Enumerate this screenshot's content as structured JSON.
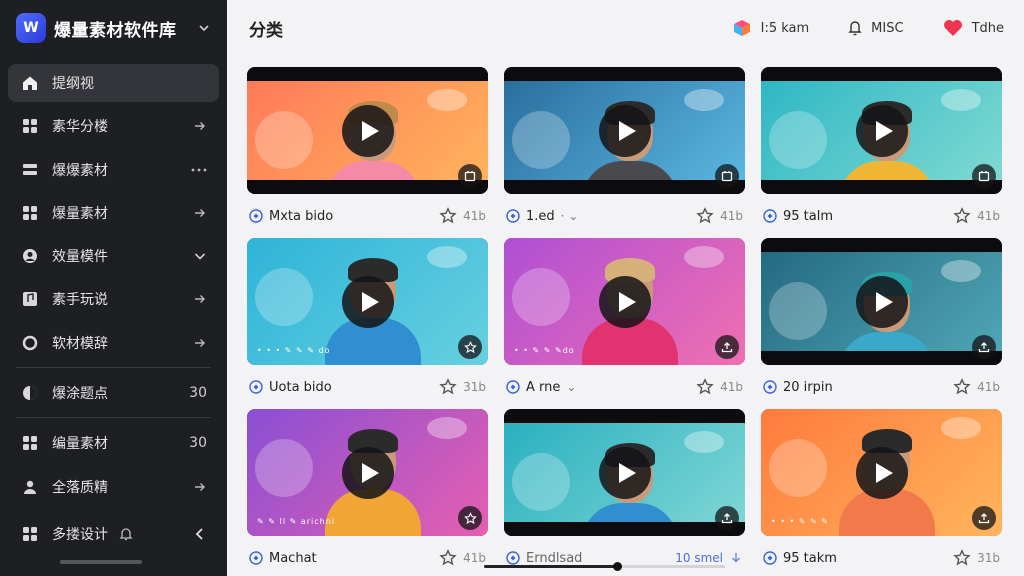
{
  "app": {
    "logo_letter": "W",
    "title": "爆量素材软件库"
  },
  "sidebar": {
    "items": [
      {
        "label": "提纲视",
        "icon": "home-icon",
        "trail": "",
        "active": true
      },
      {
        "label": "素华分楼",
        "icon": "grid-icon",
        "trail": "arrow"
      },
      {
        "label": "爆爆素材",
        "icon": "layers-icon",
        "trail": "dots"
      },
      {
        "label": "爆量素材",
        "icon": "grid-icon",
        "trail": "arrow"
      },
      {
        "label": "效量模件",
        "icon": "user-circle-icon",
        "trail": "chevron"
      },
      {
        "label": "素手玩说",
        "icon": "music-icon",
        "trail": "arrow"
      },
      {
        "label": "软材模辞",
        "icon": "ring-icon",
        "trail": "arrow"
      },
      {
        "label": "爆涂题点",
        "icon": "half-circle-icon",
        "trail": "30"
      },
      {
        "label": "编量素材",
        "icon": "grid-icon",
        "trail": "30"
      },
      {
        "label": "全落质精",
        "icon": "person-icon",
        "trail": "arrow"
      }
    ],
    "footer_label": "多搂设计"
  },
  "header": {
    "title": "分类",
    "actions": [
      {
        "label": "I:5 kam",
        "icon": "gift-icon"
      },
      {
        "label": "MISC",
        "icon": "bell-icon"
      },
      {
        "label": "Tdhe",
        "icon": "heart-icon"
      }
    ]
  },
  "cards": [
    {
      "title": "Mxta bido",
      "extra": "",
      "count": "41b",
      "corner": "frame-icon",
      "dots": "",
      "bands": true,
      "bg": [
        "#ff7a59",
        "#ffb35c"
      ],
      "hair": "#c08a4a",
      "shirt": "#f58aa8",
      "meta_icon": "shield-icon",
      "right_icon": "star-icon"
    },
    {
      "title": "1.ed",
      "extra": "·  ⌄",
      "count": "41b",
      "corner": "frame-icon",
      "dots": "",
      "bands": true,
      "bg": [
        "#2a6f9e",
        "#5ab6e0"
      ],
      "hair": "#2b2b2b",
      "shirt": "#4a4a4e",
      "meta_icon": "shield-icon",
      "right_icon": "star-icon"
    },
    {
      "title": "95 talm",
      "extra": "",
      "count": "41b",
      "corner": "frame-icon",
      "dots": "",
      "bands": true,
      "bg": [
        "#2fb7c4",
        "#7fd9d2"
      ],
      "hair": "#2b2b2b",
      "shirt": "#f1b534",
      "meta_icon": "shield-icon",
      "right_icon": "star-icon"
    },
    {
      "title": "Uota bido",
      "extra": "",
      "count": "31b",
      "corner": "star-icon",
      "dots": "• • • ✎ ✎ ✎ do",
      "bands": false,
      "bg": [
        "#2fb4d8",
        "#66d0e0"
      ],
      "hair": "#2b2b2b",
      "shirt": "#2f8fd0",
      "meta_icon": "shield-icon",
      "right_icon": "star-icon"
    },
    {
      "title": "A rne",
      "extra": "⌄",
      "count": "41b",
      "corner": "upload-icon",
      "dots": "• • ✎ ✎ ✎do",
      "bands": false,
      "bg": [
        "#b04fd4",
        "#f06fb0"
      ],
      "hair": "#d6b07a",
      "shirt": "#e0336f",
      "meta_icon": "shield-icon",
      "right_icon": "star-icon"
    },
    {
      "title": "20 irpin",
      "extra": "",
      "count": "41b",
      "corner": "upload-icon",
      "dots": "",
      "bands": true,
      "bg": [
        "#246a82",
        "#4fa6b4"
      ],
      "hair": "#2aa3a8",
      "shirt": "#3aa8c8",
      "meta_icon": "shield-icon",
      "right_icon": "star-icon"
    },
    {
      "title": "Machat",
      "extra": "",
      "count": "41b",
      "corner": "star-icon",
      "dots": "✎ ✎ Il ✎ arichni",
      "bands": false,
      "bg": [
        "#8a4fd4",
        "#e65fb0"
      ],
      "hair": "#2b2b2b",
      "shirt": "#f1a534",
      "meta_icon": "shield-icon",
      "right_icon": "star-icon"
    },
    {
      "title": "Erndlsad",
      "extra": "",
      "count": "10 smel",
      "corner": "upload-icon",
      "dots": "",
      "bands": true,
      "bg": [
        "#2ab0c0",
        "#7fd6d4"
      ],
      "hair": "#2b2b2b",
      "shirt": "#2f8fd0",
      "meta_icon": "shield-icon",
      "right_icon": "download-icon",
      "title_dim": true
    },
    {
      "title": "95 takm",
      "extra": "",
      "count": "31b",
      "corner": "upload-icon",
      "dots": "• • • ✎ ✎ ✎",
      "bands": false,
      "bg": [
        "#ff7a3d",
        "#ffb65c"
      ],
      "hair": "#2b2b2b",
      "shirt": "#f27a4a",
      "meta_icon": "shield-icon",
      "right_icon": "star-icon"
    }
  ],
  "playback": {
    "progress": 0.55
  },
  "colors": {
    "sidebar_bg": "#1e1f22",
    "active_item": "#34353a",
    "accent": "#4f6cff"
  }
}
